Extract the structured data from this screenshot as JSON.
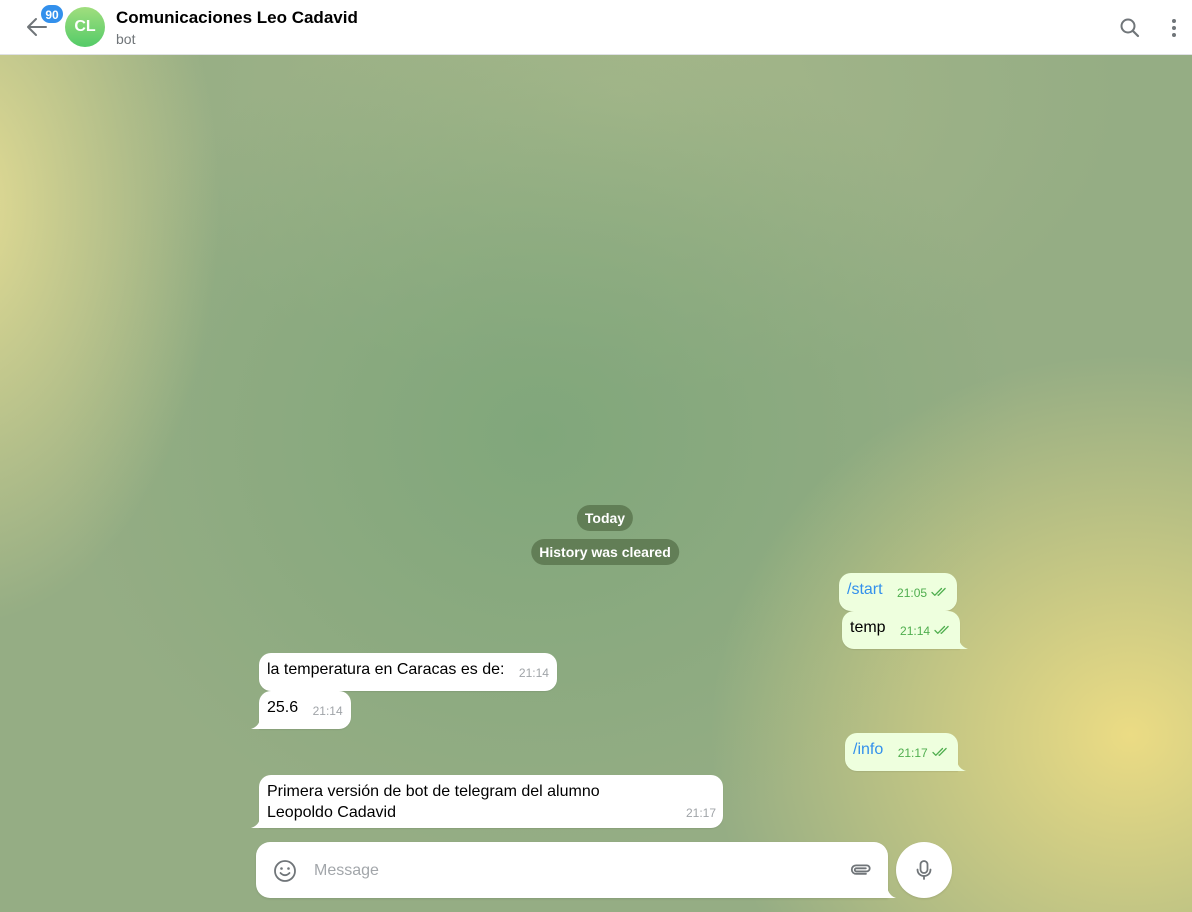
{
  "header": {
    "unread_count": "90",
    "avatar_initials": "CL",
    "chat_title": "Comunicaciones Leo Cadavid",
    "chat_status": "bot",
    "icons": [
      "back-arrow-icon",
      "search-icon",
      "more-vertical-icon"
    ]
  },
  "service": {
    "date_label": "Today",
    "history_notice": "History was cleared"
  },
  "messages": [
    {
      "direction": "out",
      "text": "/start",
      "time": "21:05",
      "status": "read"
    },
    {
      "direction": "out",
      "text": "temp",
      "time": "21:14",
      "status": "read"
    },
    {
      "direction": "in",
      "text": "la temperatura en Caracas es de:",
      "time": "21:14"
    },
    {
      "direction": "in",
      "text": "25.6",
      "time": "21:14"
    },
    {
      "direction": "out",
      "text": "/info",
      "time": "21:17",
      "status": "read"
    },
    {
      "direction": "in",
      "text": "Primera versión de bot de telegram del alumno Leopoldo Cadavid",
      "time": "21:17"
    }
  ],
  "composer": {
    "placeholder": "Message",
    "icons": [
      "emoji-icon",
      "paperclip-icon",
      "microphone-icon"
    ]
  },
  "colors": {
    "accent": "#3390ec",
    "outgoing_bubble": "#eeffde",
    "incoming_bubble": "#ffffff",
    "read_check": "#4fae4e"
  }
}
